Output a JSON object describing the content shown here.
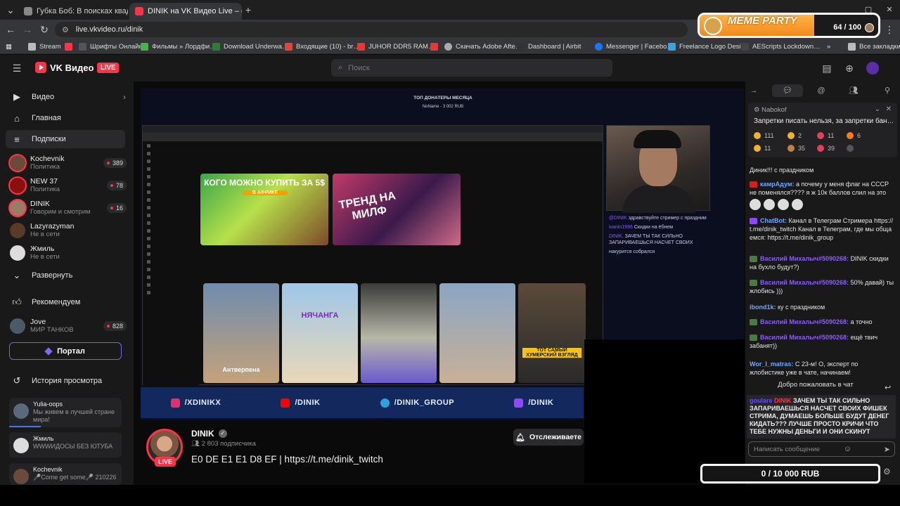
{
  "browser": {
    "tabs": [
      {
        "title": "Губка Боб: В поисках квадратн…",
        "active": false
      },
      {
        "title": "DINIK на VK Видео Live – с…",
        "active": true
      }
    ],
    "url": "live.vkvideo.ru/dinik",
    "bookmarks": [
      "Stream",
      "Шрифты Онлайн",
      "Фильмы » Лордфи…",
      "Download Underwa…",
      "Входящие (10) - br…",
      "JUHOR DDR5 RAM…",
      "Скачать Adobe Afte…",
      "Dashboard | Airbit",
      "Messenger | Facebo…",
      "Freelance Logo Desi…",
      "AEScripts Lockdown…",
      "Все закладки"
    ]
  },
  "meme_party": {
    "title": "MEME PARTY",
    "count": "64 / 100",
    "progress": 0.64
  },
  "vk": {
    "logo_name": "VK Видео",
    "logo_live": "LIVE",
    "search_placeholder": "Поиск"
  },
  "sidebar": {
    "nav": [
      {
        "label": "Видео",
        "icon": "video-icon"
      },
      {
        "label": "Главная",
        "icon": "home-icon"
      },
      {
        "label": "Подписки",
        "icon": "subscriptions-icon"
      }
    ],
    "subs": [
      {
        "name": "Kochevnik",
        "sub": "Политика",
        "badge": "389",
        "color": "#6a4a3a"
      },
      {
        "name": "NEW 37",
        "sub": "Политика",
        "badge": "78",
        "color": "#8a1010"
      },
      {
        "name": "DINIK",
        "sub": "Говорим и смотрим",
        "badge": "16",
        "color": "#9b7a66"
      },
      {
        "name": "Lazyrazyman",
        "sub": "Не в сети",
        "badge": "",
        "color": "#5a3a2a"
      },
      {
        "name": "Жмиль",
        "sub": "Не в сети",
        "badge": "",
        "color": "#ddd"
      }
    ],
    "expand": "Развернуть",
    "recommend": "Рекомендуем",
    "recommend_item": {
      "name": "Jove",
      "sub": "МИР ТАНКОВ",
      "badge": "828"
    },
    "portal": "Портал",
    "history_title": "История просмотра",
    "history": [
      {
        "name": "Yulia-oops",
        "sub": "Мы живем в лучшей стране мира!",
        "progress": 0.28
      },
      {
        "name": "Жмиль",
        "sub": "WWWИДОСЫ БЕЗ ЮТУБА",
        "progress": 0.0
      },
      {
        "name": "Kochevnik",
        "sub": "🎤Come get some🎤 210226",
        "progress": 0.0
      }
    ]
  },
  "stream": {
    "donors_title": "ТОП ДОНАТЕРЫ МЕСЯЦА",
    "donors_line": "NoName - 3 002 RUB",
    "thumb1": "КОГО МОЖНО КУПИТЬ ЗА 5$",
    "thumb1_sub": "В АФРИКЕ",
    "thumb2": "ТРЕНД НА МИЛФ",
    "short1": "Антверпена",
    "short2": "НЯЧАНГА",
    "short5": "ТОТ САМЫЙ ХУМЕРСКИЙ ВЗГЛЯД",
    "cam_chat": [
      {
        "u": "@DINIK",
        "t": "здравствуйте стример с праздним"
      },
      {
        "u": "ivanin1996",
        "t": "Скидки на ёбнем"
      },
      {
        "u": "DINIK,",
        "t": "ЗАЧЕМ ТЫ ТАК СИЛЬНО ЗАПАРИВАЕШЬСЯ НАСЧЕТ СВОИХ"
      },
      {
        "u": "",
        "t": "накурится собрался"
      }
    ],
    "socials": [
      "/XDINIKX",
      "/DINIK",
      "/DINIK_GROUP",
      "/DINIK"
    ]
  },
  "channel": {
    "name": "DINIK",
    "subs": "2 803 подписчика",
    "title": "E0 DE E1 E1 D8 EF | https://t.me/dinik_twitch",
    "live": "LIVE",
    "follow": "Отслеживаете"
  },
  "chat": {
    "pinned_user": "Nabokof",
    "pinned_msg": "Запретки писать нельзя, за запретки бан…",
    "reactions": [
      {
        "n": "111",
        "c": "#f0b429"
      },
      {
        "n": "2",
        "c": "#f0b429"
      },
      {
        "n": "11",
        "c": "#e0405a"
      },
      {
        "n": "6",
        "c": "#ff7a1a"
      },
      {
        "n": "11",
        "c": "#f0b429"
      },
      {
        "n": "35",
        "c": "#c08040"
      },
      {
        "n": "39",
        "c": "#e0405a"
      }
    ],
    "messages": [
      {
        "u": "",
        "t": "Диник!!! с праздником",
        "uc": "#e4e4e4"
      },
      {
        "u": "камрАдум:",
        "t": "а почему у меня флаг на СССР не поменялся???? я ж 10к баллов слил на это",
        "uc": "#6fa8ff"
      },
      {
        "u": "ChatBot:",
        "t": "Канал в Телеграм Стримера https://t.me/dinik_twitch Канал в Телеграм, где мы общаемся: https://t.me/dinik_group",
        "uc": "#6fa8ff"
      },
      {
        "u": "Василий Михалыч#5090268:",
        "t": "DINIK скидки на бухло будут?)",
        "uc": "#8a5cff"
      },
      {
        "u": "Василий Михалыч#5090268:",
        "t": "50% давай) ты жлобись )))",
        "uc": "#8a5cff"
      },
      {
        "u": "ibond1k:",
        "t": "ку с праздником",
        "uc": "#6fa8ff"
      },
      {
        "u": "Василий Михалыч#5090268:",
        "t": "а точно",
        "uc": "#8a5cff"
      },
      {
        "u": "Василий Михалыч#5090268:",
        "t": "ещё твич забанят))",
        "uc": "#8a5cff"
      },
      {
        "u": "Wor_l_matras:",
        "t": "С 23-м! О, эксперт по жлобистике уже в чате, начинаем!",
        "uc": "#6fa8ff"
      }
    ],
    "welcome": "Добро пожаловать в чат",
    "highlight_user": "goulare",
    "highlight_mention": "DINIK",
    "highlight_text": "ЗАЧЕМ ТЫ ТАК СИЛЬНО ЗАПАРИВАЕШЬСЯ НАСЧЕТ СВОИХ ФИШЕК СТРИМА, ДУМАЕШЬ БОЛЬШЕ БУДУТ ДЕНЕГ КИДАТЬ??? ЛУЧШЕ ПРОСТО КРИЧИ ЧТО ТЕБЕ НУЖНЫ ДЕНЬГИ И ОНИ СКИНУТ",
    "input_placeholder": "Написать сообщение"
  },
  "donate_goal": "0 / 10 000 RUB"
}
